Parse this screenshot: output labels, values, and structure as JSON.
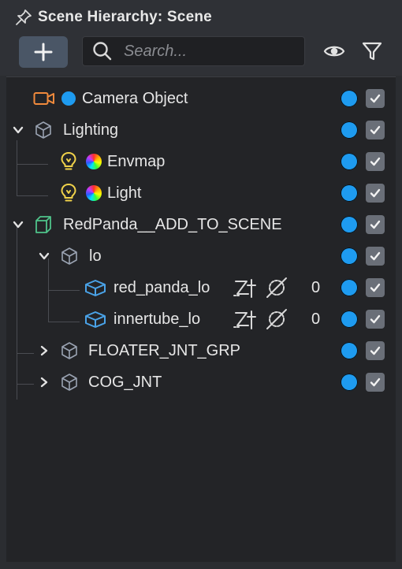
{
  "panel": {
    "title": "Scene Hierarchy: Scene"
  },
  "search": {
    "placeholder": "Search..."
  },
  "tree": {
    "camera": {
      "label": "Camera Object"
    },
    "lighting": {
      "label": "Lighting"
    },
    "envmap": {
      "label": "Envmap"
    },
    "light": {
      "label": "Light"
    },
    "redpanda": {
      "label": "RedPanda__ADD_TO_SCENE"
    },
    "lo": {
      "label": "lo"
    },
    "red_panda_lo": {
      "label": "red_panda_lo",
      "count": "0"
    },
    "innertube_lo": {
      "label": "innertube_lo",
      "count": "0"
    },
    "floater": {
      "label": "FLOATER_JNT_GRP"
    },
    "cog": {
      "label": "COG_JNT"
    }
  },
  "colors": {
    "visible_dot": "#1e9bf0",
    "camera_icon": "#f08a3c",
    "light_icon": "#f0d24a",
    "group_icon": "#4fc38a",
    "mesh_icon": "#4aa3e8"
  }
}
